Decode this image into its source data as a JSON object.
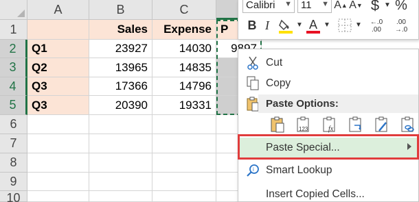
{
  "columns": [
    "A",
    "B",
    "C",
    "P"
  ],
  "rows": [
    "1",
    "2",
    "3",
    "4",
    "5",
    "6",
    "7",
    "8",
    "9",
    "10"
  ],
  "table": {
    "headers": [
      "Sales",
      "Expense"
    ],
    "data": [
      {
        "label": "Q1",
        "sales": "23927",
        "expense": "14030"
      },
      {
        "label": "Q2",
        "sales": "13965",
        "expense": "14835"
      },
      {
        "label": "Q3",
        "sales": "17366",
        "expense": "14796"
      },
      {
        "label": "Q3",
        "sales": "20390",
        "expense": "19331"
      }
    ],
    "partial_value": "9897"
  },
  "minibar": {
    "font": "Calibri",
    "size": "11",
    "bold": "B",
    "italic": "I",
    "currency": "$",
    "percent": "%",
    "inc_decimal": "←.0 .00",
    "dec_decimal": ".00 →.0",
    "font_color": "#e81123",
    "fill_color": "#ffe100"
  },
  "menu": {
    "cut": "Cut",
    "copy": "Copy",
    "paste_options": "Paste Options:",
    "paste_special": "Paste Special...",
    "smart_lookup": "Smart Lookup",
    "insert_copied": "Insert Copied Cells..."
  },
  "colors": {
    "accent": "#217346",
    "peach": "#fce4d6",
    "highlight_outline": "#e03c3c",
    "menu_highlight": "#dcefdc"
  }
}
